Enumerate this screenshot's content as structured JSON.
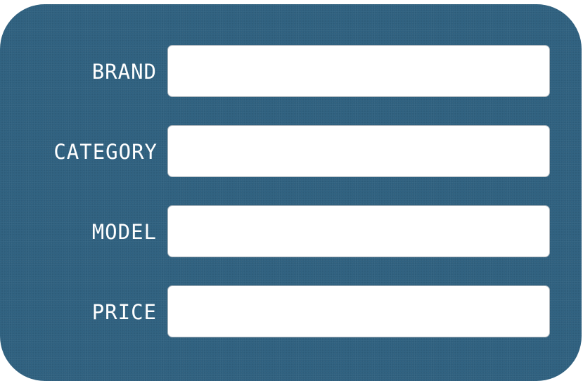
{
  "form": {
    "fields": [
      {
        "label": "BRAND",
        "value": "",
        "placeholder": ""
      },
      {
        "label": "CATEGORY",
        "value": "",
        "placeholder": ""
      },
      {
        "label": "MODEL",
        "value": "",
        "placeholder": ""
      },
      {
        "label": "PRICE",
        "value": "",
        "placeholder": ""
      }
    ]
  },
  "colors": {
    "panel_background": "#2f6180",
    "label_text": "#ffffff",
    "field_background": "#ffffff",
    "field_border": "#a9b3ba"
  }
}
